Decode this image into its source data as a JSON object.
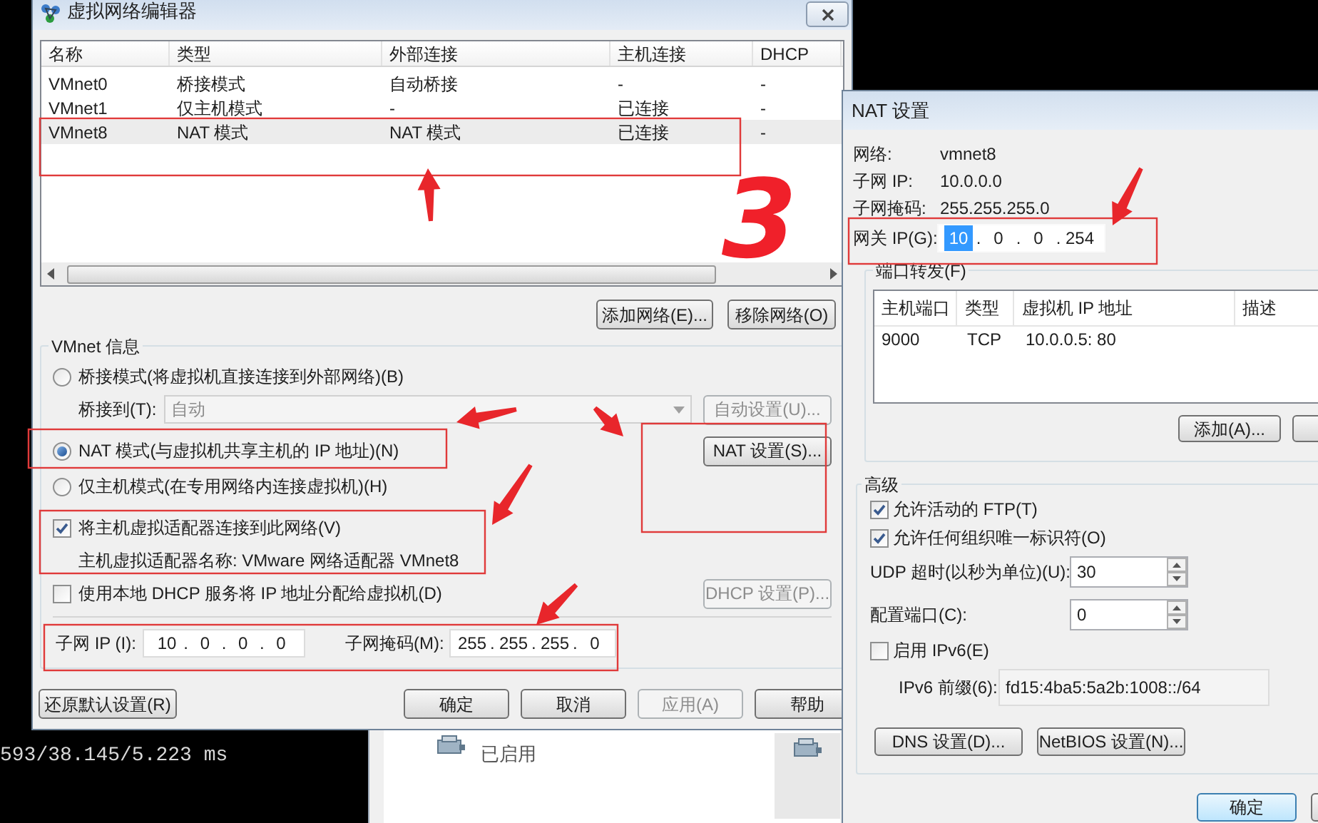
{
  "terminal": {
    "lines": [
      "593/38.145/5.223 ms"
    ]
  },
  "background_window": {
    "status": "已启用"
  },
  "main_dialog": {
    "title": "虚拟网络编辑器",
    "networks_table": {
      "columns": [
        "名称",
        "类型",
        "外部连接",
        "主机连接",
        "DHCP"
      ],
      "rows": [
        {
          "cells": [
            "VMnet0",
            "桥接模式",
            "自动桥接",
            "-",
            "-"
          ],
          "selected": false
        },
        {
          "cells": [
            "VMnet1",
            "仅主机模式",
            "-",
            "已连接",
            "-"
          ],
          "selected": false
        },
        {
          "cells": [
            "VMnet8",
            "NAT 模式",
            "NAT 模式",
            "已连接",
            "-"
          ],
          "selected": true
        }
      ]
    },
    "list_buttons": [
      {
        "label": "添加网络(E)..."
      },
      {
        "label": "移除网络(O)"
      }
    ],
    "info_group": {
      "title": "VMnet 信息",
      "modes": [
        {
          "label": "桥接模式(将虚拟机直接连接到外部网络)(B)",
          "selected": false
        },
        {
          "label": "NAT 模式(与虚拟机共享主机的 IP 地址)(N)",
          "selected": true
        },
        {
          "label": "仅主机模式(在专用网络内连接虚拟机)(H)",
          "selected": false
        }
      ],
      "bridge_to": {
        "label": "桥接到(T):",
        "value": "自动",
        "disabled": true
      },
      "auto_settings_button": {
        "label": "自动设置(U)...",
        "disabled": true
      },
      "nat_settings_button": {
        "label": "NAT 设置(S)...",
        "disabled": false
      },
      "connect_adapter": {
        "label": "将主机虚拟适配器连接到此网络(V)",
        "checked": true
      },
      "adapter_name": "主机虚拟适配器名称: VMware 网络适配器 VMnet8",
      "use_dhcp": {
        "label": "使用本地 DHCP 服务将 IP 地址分配给虚拟机(D)",
        "checked": false
      },
      "dhcp_settings_button": {
        "label": "DHCP 设置(P)...",
        "disabled": true
      },
      "subnet_ip": {
        "label": "子网 IP (I):",
        "separator": ".",
        "octets": [
          {
            "text": "10",
            "selected": false
          },
          {
            "text": "0",
            "selected": false
          },
          {
            "text": "0",
            "selected": false
          },
          {
            "text": "0",
            "selected": false
          }
        ]
      },
      "subnet_mask": {
        "label": "子网掩码(M):",
        "separator": ".",
        "octets": [
          {
            "text": "255",
            "selected": false
          },
          {
            "text": "255",
            "selected": false
          },
          {
            "text": "255",
            "selected": false
          },
          {
            "text": "0",
            "selected": false
          }
        ]
      }
    },
    "footer_buttons": [
      {
        "label": "还原默认设置(R)",
        "disabled": false
      },
      {
        "label": "确定",
        "disabled": false
      },
      {
        "label": "取消",
        "disabled": false
      },
      {
        "label": "应用(A)",
        "disabled": true
      },
      {
        "label": "帮助",
        "disabled": false
      }
    ]
  },
  "nat_dialog": {
    "title": "NAT 设置",
    "info": [
      {
        "label": "网络:",
        "value": "vmnet8"
      },
      {
        "label": "子网 IP:",
        "value": "10.0.0.0"
      },
      {
        "label": "子网掩码:",
        "value": "255.255.255.0"
      }
    ],
    "gateway": {
      "label": "网关 IP(G):",
      "separator": ".",
      "octets": [
        {
          "text": "10",
          "selected": true
        },
        {
          "text": "0",
          "selected": false
        },
        {
          "text": "0",
          "selected": false
        },
        {
          "text": "254",
          "selected": false
        }
      ]
    },
    "port_forwarding": {
      "title": "端口转发(F)",
      "columns": [
        "主机端口",
        "类型",
        "虚拟机 IP 地址",
        "描述"
      ],
      "rows": [
        {
          "cells": [
            "9000",
            "TCP",
            "10.0.0.5: 80"
          ]
        }
      ],
      "add_button": {
        "label": "添加(A)..."
      }
    },
    "advanced": {
      "title": "高级",
      "options": [
        {
          "label": "允许活动的 FTP(T)",
          "checked": true
        },
        {
          "label": "允许任何组织唯一标识符(O)",
          "checked": true
        }
      ],
      "spinners": [
        {
          "label": "UDP 超时(以秒为单位)(U):",
          "value": "30"
        },
        {
          "label": "配置端口(C):",
          "value": "0"
        }
      ],
      "enable_ipv6": {
        "label": "启用 IPv6(E)",
        "checked": false
      },
      "ipv6_prefix": {
        "label": "IPv6 前缀(6):",
        "value": "fd15:4ba5:5a2b:1008::/64"
      },
      "buttons": [
        {
          "label": "DNS 设置(D)..."
        },
        {
          "label": "NetBIOS 设置(N)..."
        }
      ]
    },
    "footer_buttons": [
      {
        "label": "确定",
        "default": true
      }
    ]
  },
  "annotation": {
    "number": "3"
  }
}
